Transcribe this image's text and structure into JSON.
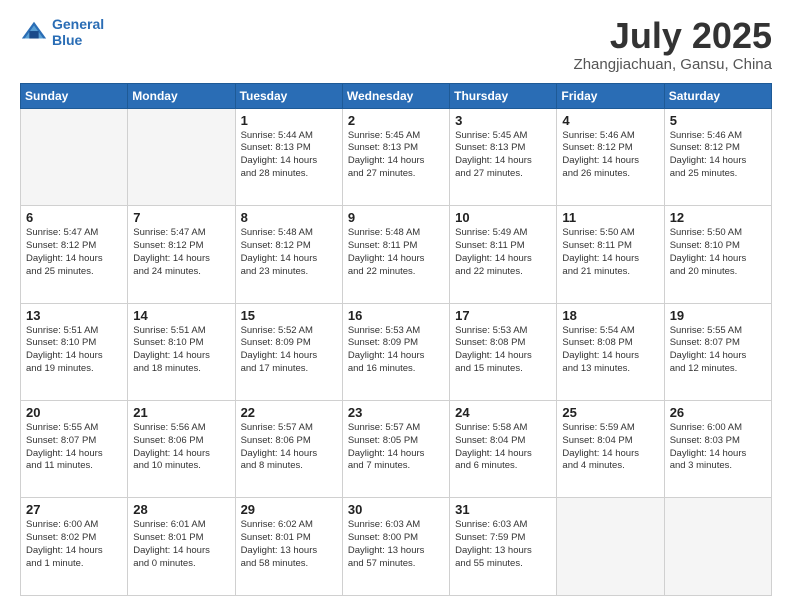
{
  "header": {
    "logo_line1": "General",
    "logo_line2": "Blue",
    "month": "July 2025",
    "location": "Zhangjiachuan, Gansu, China"
  },
  "weekdays": [
    "Sunday",
    "Monday",
    "Tuesday",
    "Wednesday",
    "Thursday",
    "Friday",
    "Saturday"
  ],
  "weeks": [
    [
      {
        "day": "",
        "content": ""
      },
      {
        "day": "",
        "content": ""
      },
      {
        "day": "1",
        "content": "Sunrise: 5:44 AM\nSunset: 8:13 PM\nDaylight: 14 hours\nand 28 minutes."
      },
      {
        "day": "2",
        "content": "Sunrise: 5:45 AM\nSunset: 8:13 PM\nDaylight: 14 hours\nand 27 minutes."
      },
      {
        "day": "3",
        "content": "Sunrise: 5:45 AM\nSunset: 8:13 PM\nDaylight: 14 hours\nand 27 minutes."
      },
      {
        "day": "4",
        "content": "Sunrise: 5:46 AM\nSunset: 8:12 PM\nDaylight: 14 hours\nand 26 minutes."
      },
      {
        "day": "5",
        "content": "Sunrise: 5:46 AM\nSunset: 8:12 PM\nDaylight: 14 hours\nand 25 minutes."
      }
    ],
    [
      {
        "day": "6",
        "content": "Sunrise: 5:47 AM\nSunset: 8:12 PM\nDaylight: 14 hours\nand 25 minutes."
      },
      {
        "day": "7",
        "content": "Sunrise: 5:47 AM\nSunset: 8:12 PM\nDaylight: 14 hours\nand 24 minutes."
      },
      {
        "day": "8",
        "content": "Sunrise: 5:48 AM\nSunset: 8:12 PM\nDaylight: 14 hours\nand 23 minutes."
      },
      {
        "day": "9",
        "content": "Sunrise: 5:48 AM\nSunset: 8:11 PM\nDaylight: 14 hours\nand 22 minutes."
      },
      {
        "day": "10",
        "content": "Sunrise: 5:49 AM\nSunset: 8:11 PM\nDaylight: 14 hours\nand 22 minutes."
      },
      {
        "day": "11",
        "content": "Sunrise: 5:50 AM\nSunset: 8:11 PM\nDaylight: 14 hours\nand 21 minutes."
      },
      {
        "day": "12",
        "content": "Sunrise: 5:50 AM\nSunset: 8:10 PM\nDaylight: 14 hours\nand 20 minutes."
      }
    ],
    [
      {
        "day": "13",
        "content": "Sunrise: 5:51 AM\nSunset: 8:10 PM\nDaylight: 14 hours\nand 19 minutes."
      },
      {
        "day": "14",
        "content": "Sunrise: 5:51 AM\nSunset: 8:10 PM\nDaylight: 14 hours\nand 18 minutes."
      },
      {
        "day": "15",
        "content": "Sunrise: 5:52 AM\nSunset: 8:09 PM\nDaylight: 14 hours\nand 17 minutes."
      },
      {
        "day": "16",
        "content": "Sunrise: 5:53 AM\nSunset: 8:09 PM\nDaylight: 14 hours\nand 16 minutes."
      },
      {
        "day": "17",
        "content": "Sunrise: 5:53 AM\nSunset: 8:08 PM\nDaylight: 14 hours\nand 15 minutes."
      },
      {
        "day": "18",
        "content": "Sunrise: 5:54 AM\nSunset: 8:08 PM\nDaylight: 14 hours\nand 13 minutes."
      },
      {
        "day": "19",
        "content": "Sunrise: 5:55 AM\nSunset: 8:07 PM\nDaylight: 14 hours\nand 12 minutes."
      }
    ],
    [
      {
        "day": "20",
        "content": "Sunrise: 5:55 AM\nSunset: 8:07 PM\nDaylight: 14 hours\nand 11 minutes."
      },
      {
        "day": "21",
        "content": "Sunrise: 5:56 AM\nSunset: 8:06 PM\nDaylight: 14 hours\nand 10 minutes."
      },
      {
        "day": "22",
        "content": "Sunrise: 5:57 AM\nSunset: 8:06 PM\nDaylight: 14 hours\nand 8 minutes."
      },
      {
        "day": "23",
        "content": "Sunrise: 5:57 AM\nSunset: 8:05 PM\nDaylight: 14 hours\nand 7 minutes."
      },
      {
        "day": "24",
        "content": "Sunrise: 5:58 AM\nSunset: 8:04 PM\nDaylight: 14 hours\nand 6 minutes."
      },
      {
        "day": "25",
        "content": "Sunrise: 5:59 AM\nSunset: 8:04 PM\nDaylight: 14 hours\nand 4 minutes."
      },
      {
        "day": "26",
        "content": "Sunrise: 6:00 AM\nSunset: 8:03 PM\nDaylight: 14 hours\nand 3 minutes."
      }
    ],
    [
      {
        "day": "27",
        "content": "Sunrise: 6:00 AM\nSunset: 8:02 PM\nDaylight: 14 hours\nand 1 minute."
      },
      {
        "day": "28",
        "content": "Sunrise: 6:01 AM\nSunset: 8:01 PM\nDaylight: 14 hours\nand 0 minutes."
      },
      {
        "day": "29",
        "content": "Sunrise: 6:02 AM\nSunset: 8:01 PM\nDaylight: 13 hours\nand 58 minutes."
      },
      {
        "day": "30",
        "content": "Sunrise: 6:03 AM\nSunset: 8:00 PM\nDaylight: 13 hours\nand 57 minutes."
      },
      {
        "day": "31",
        "content": "Sunrise: 6:03 AM\nSunset: 7:59 PM\nDaylight: 13 hours\nand 55 minutes."
      },
      {
        "day": "",
        "content": ""
      },
      {
        "day": "",
        "content": ""
      }
    ]
  ]
}
